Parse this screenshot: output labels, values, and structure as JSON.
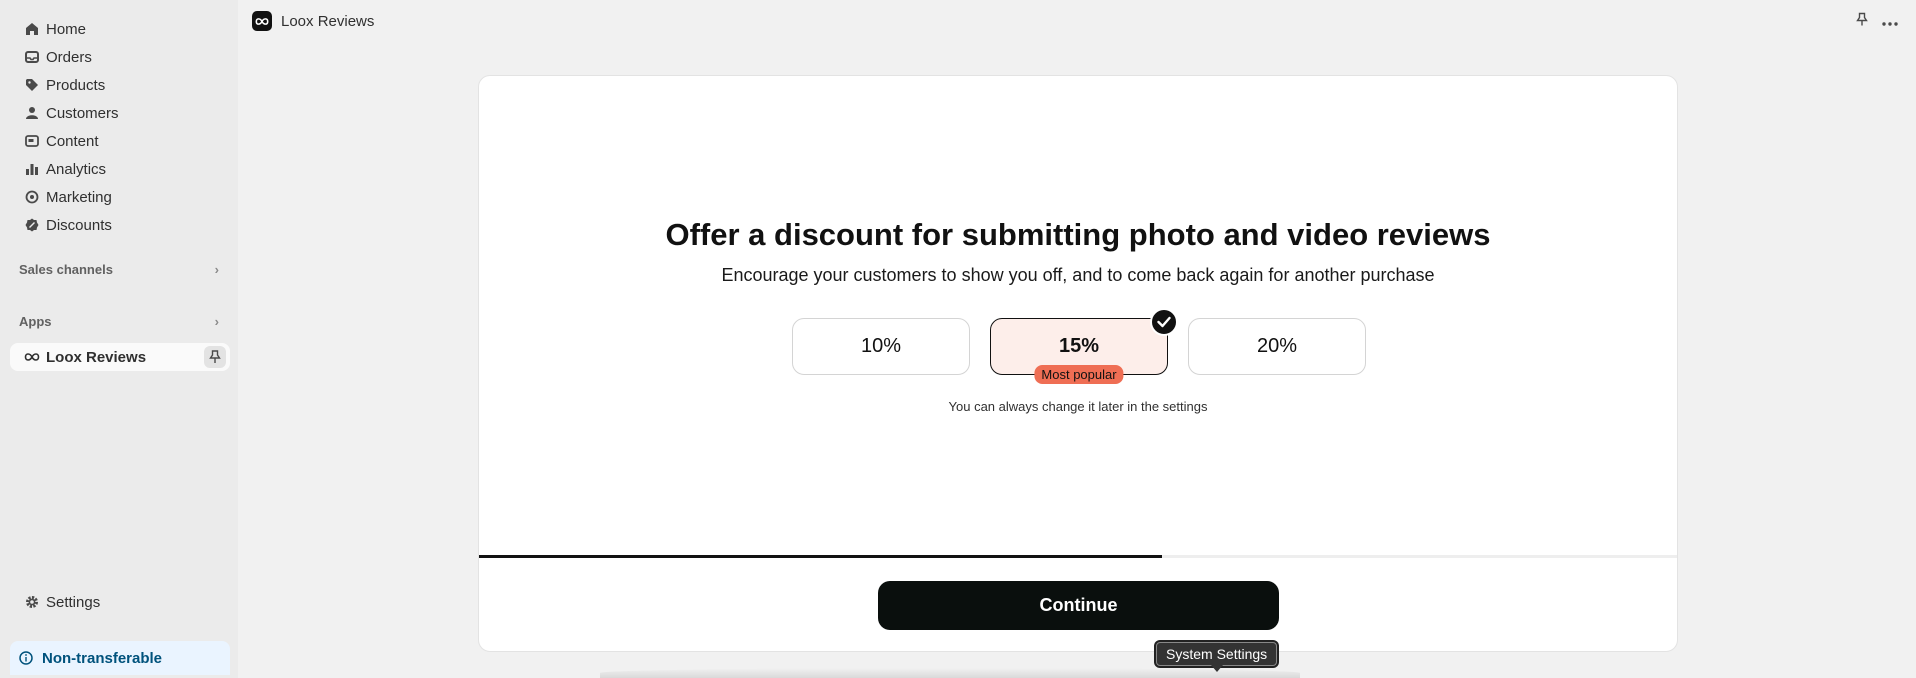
{
  "sidebar": {
    "items": [
      {
        "label": "Home",
        "icon": "home-icon"
      },
      {
        "label": "Orders",
        "icon": "inbox-icon"
      },
      {
        "label": "Products",
        "icon": "tag-icon"
      },
      {
        "label": "Customers",
        "icon": "person-icon"
      },
      {
        "label": "Content",
        "icon": "image-icon"
      },
      {
        "label": "Analytics",
        "icon": "bar-chart-icon"
      },
      {
        "label": "Marketing",
        "icon": "target-icon"
      },
      {
        "label": "Discounts",
        "icon": "discount-icon"
      }
    ],
    "sales_channels": "Sales channels",
    "apps": "Apps",
    "app_item": "Loox Reviews",
    "settings": "Settings",
    "non_transferable": "Non-transferable"
  },
  "topbar": {
    "app_title": "Loox Reviews"
  },
  "main": {
    "heading": "Offer a discount for submitting photo and video reviews",
    "subheading": "Encourage your customers to show you off, and to come back again for another purchase",
    "options": [
      {
        "label": "10%",
        "selected": false
      },
      {
        "label": "15%",
        "selected": true,
        "badge": "Most popular"
      },
      {
        "label": "20%",
        "selected": false
      }
    ],
    "note": "You can always change it later in the settings",
    "progress": 0.57,
    "continue_label": "Continue"
  },
  "tooltip": "System Settings",
  "colors": {
    "accent": "#0a0f0d",
    "badge": "#ef6e54",
    "selected_bg": "#fdeeea",
    "non_transferable_bg": "#eaf4ff"
  }
}
